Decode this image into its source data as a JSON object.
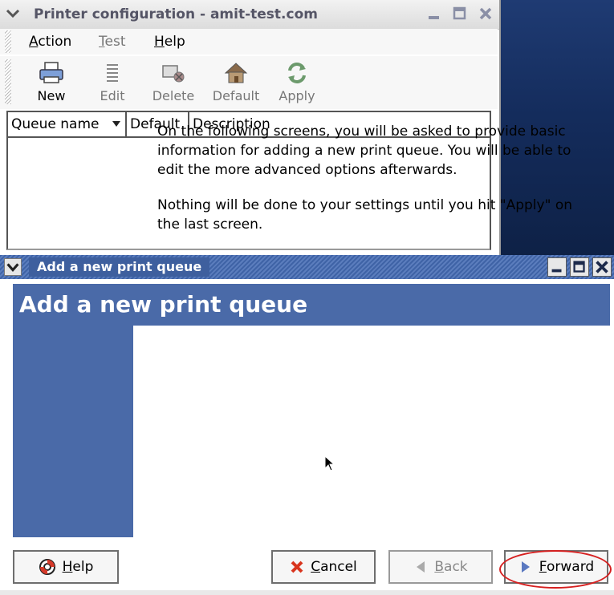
{
  "desktop": {
    "color": "#142c5c"
  },
  "win1": {
    "title": "Printer configuration - amit-test.com",
    "menu": [
      {
        "label": "Action",
        "mnemonic": "A"
      },
      {
        "label": "Test",
        "mnemonic": "T",
        "disabled": true
      },
      {
        "label": "Help",
        "mnemonic": "H"
      }
    ],
    "toolbar": [
      {
        "label": "New",
        "icon": "printer-icon",
        "disabled": false
      },
      {
        "label": "Edit",
        "icon": "edit-icon",
        "disabled": true
      },
      {
        "label": "Delete",
        "icon": "delete-icon",
        "disabled": true
      },
      {
        "label": "Default",
        "icon": "home-icon",
        "disabled": true
      },
      {
        "label": "Apply",
        "icon": "apply-icon",
        "disabled": true
      }
    ],
    "columns": [
      "Queue name",
      "Default",
      "Description"
    ]
  },
  "win2": {
    "title": "Add a new print queue",
    "banner": "Add a new print queue",
    "para1": "On the following screens, you will be asked to provide basic information for adding a new print queue.  You will be able to edit the more advanced options afterwards.",
    "para2": "Nothing will be done to your settings until you hit \"Apply\" on the last screen.",
    "buttons": {
      "help": "Help",
      "cancel": "Cancel",
      "back": "Back",
      "forward": "Forward"
    },
    "accent": "#4a6aa8",
    "highlight": "#d62020"
  }
}
